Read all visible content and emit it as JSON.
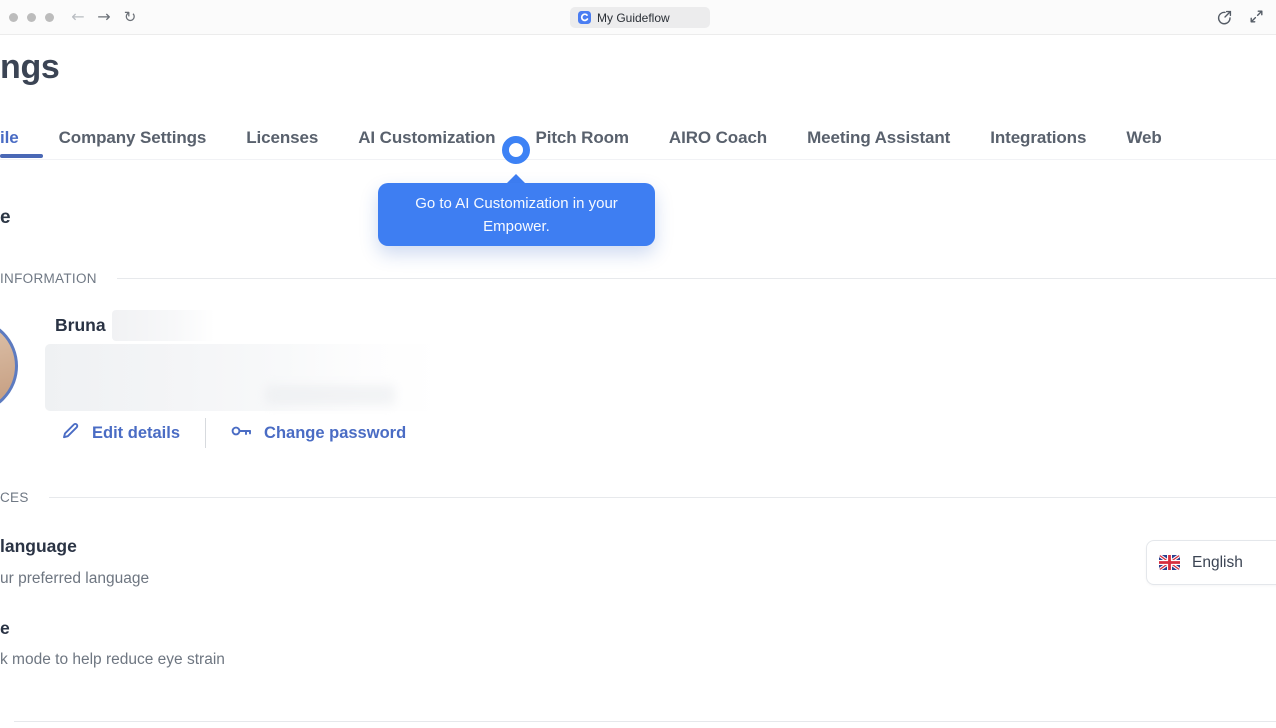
{
  "browser": {
    "tab_title": "My Guideflow",
    "icons": {
      "back": "←",
      "forward": "→",
      "reload": "↻"
    }
  },
  "page": {
    "title_partial": "ngs",
    "tabs": [
      {
        "label": "ile",
        "active": true
      },
      {
        "label": "Company Settings",
        "active": false
      },
      {
        "label": "Licenses",
        "active": false
      },
      {
        "label": "AI Customization",
        "active": false
      },
      {
        "label": "Pitch Room",
        "active": false
      },
      {
        "label": "AIRO Coach",
        "active": false
      },
      {
        "label": "Meeting Assistant",
        "active": false
      },
      {
        "label": "Integrations",
        "active": false
      },
      {
        "label": "Web",
        "active": false
      }
    ],
    "tour_tooltip": "Go to AI Customization in your Empower."
  },
  "information_section": {
    "heading_partial": "e",
    "label_partial": "INFORMATION",
    "user_first_name": "Bruna",
    "edit_details_label": "Edit details",
    "change_password_label": "Change password"
  },
  "preferences_section": {
    "label_partial": "CES",
    "language_title_partial": "language",
    "language_subtitle_partial": "ur preferred language",
    "language_selected": "English",
    "dark_mode_title_partial": "e",
    "dark_mode_subtitle_partial": "k mode to help reduce eye strain"
  },
  "colors": {
    "accent_blue": "#4a6cc4",
    "tooltip_blue": "#3e7ef2",
    "focus_ring_blue": "#3d82f5",
    "title_dark": "#3b4454",
    "tab_gray": "#59616d",
    "divider": "#e7e9ec"
  }
}
